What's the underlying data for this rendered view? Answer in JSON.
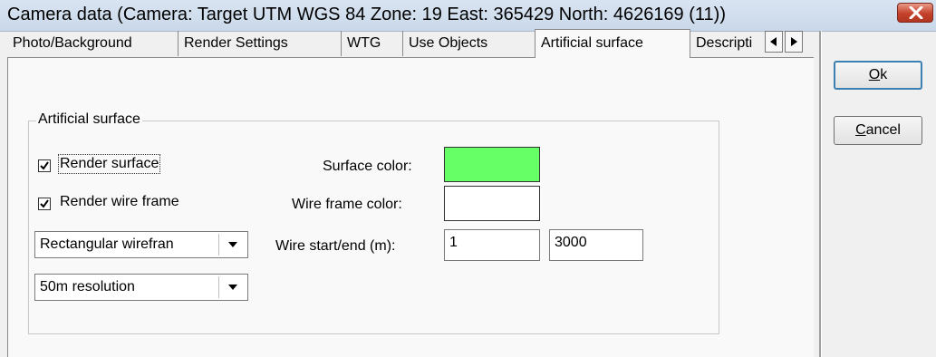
{
  "window": {
    "title": "Camera data  (Camera:  Target UTM WGS 84 Zone: 19  East: 365429  North: 4626169 (11))"
  },
  "tabs": [
    {
      "label": "Photo/Background"
    },
    {
      "label": "Render Settings"
    },
    {
      "label": "WTG"
    },
    {
      "label": "Use Objects"
    },
    {
      "label": "Artificial surface",
      "active": true
    },
    {
      "label": "Descripti"
    }
  ],
  "tab_scroll": {
    "left_icon": "triangle-left-icon",
    "right_icon": "triangle-right-icon"
  },
  "group": {
    "label": "Artificial surface"
  },
  "render_surface": {
    "label": "Render surface",
    "checked": true
  },
  "render_wireframe": {
    "label": "Render wire frame",
    "checked": true
  },
  "wireframe_type": {
    "value": "Rectangular wirefran"
  },
  "resolution": {
    "value": "50m resolution"
  },
  "surface_color": {
    "label": "Surface color:",
    "color": "#66ff66"
  },
  "wireframe_color": {
    "label": "Wire frame color:",
    "color": "#ffffff"
  },
  "wire_range": {
    "label": "Wire start/end (m):",
    "start": "1",
    "end": "3000"
  },
  "buttons": {
    "ok": {
      "mnemonic": "O",
      "rest": "k"
    },
    "cancel": {
      "mnemonic": "C",
      "rest": "ancel"
    }
  }
}
